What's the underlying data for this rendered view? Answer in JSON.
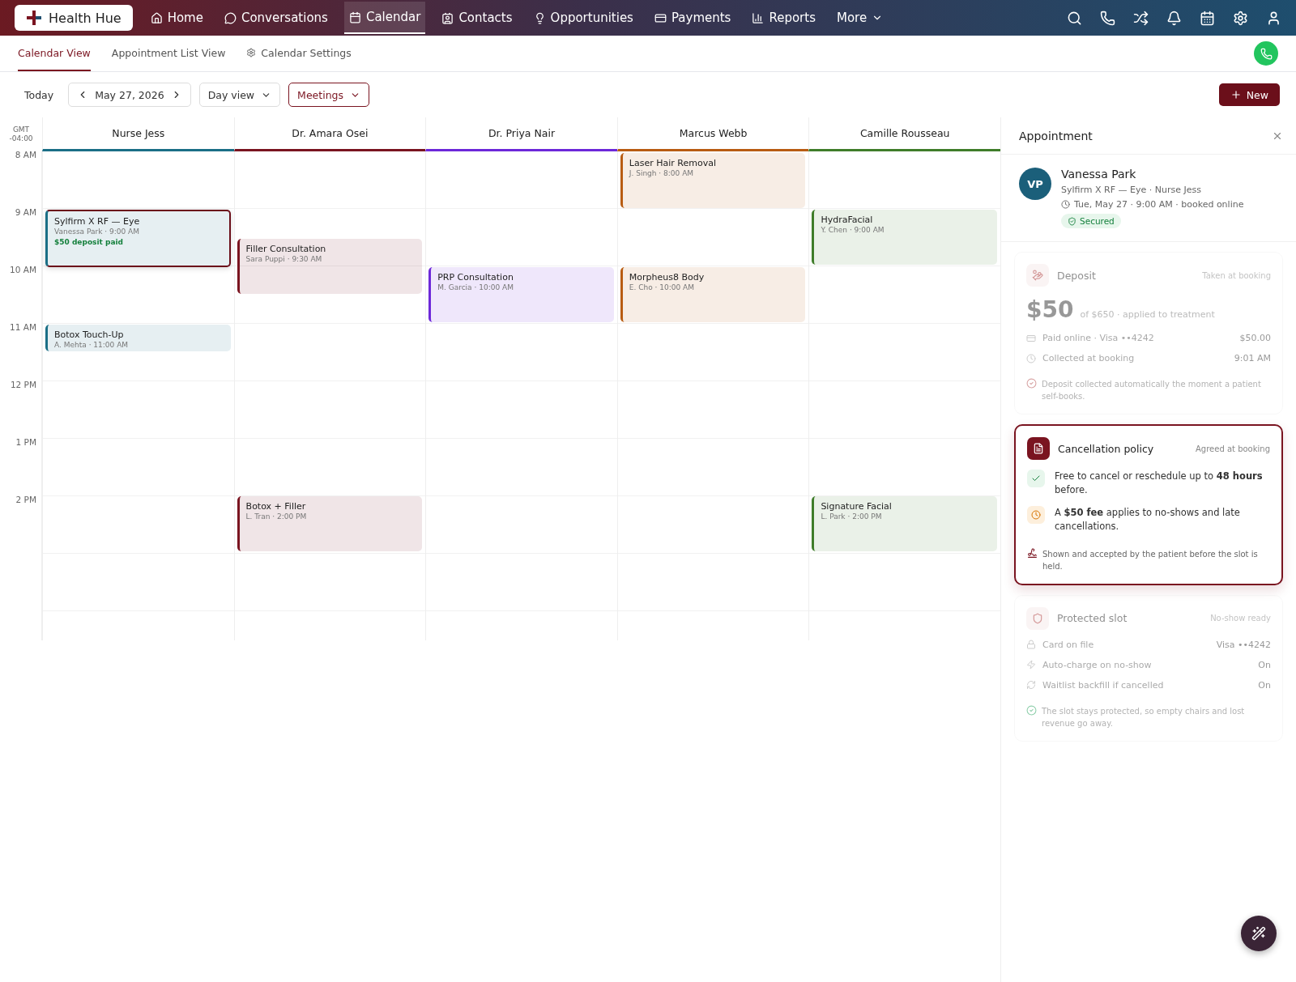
{
  "nav": {
    "brand": "Health Hue",
    "items": [
      {
        "label": "Home",
        "selected": false
      },
      {
        "label": "Conversations",
        "selected": false
      },
      {
        "label": "Calendar",
        "selected": true
      },
      {
        "label": "Contacts",
        "selected": false
      },
      {
        "label": "Opportunities",
        "selected": false
      },
      {
        "label": "Payments",
        "selected": false
      },
      {
        "label": "Reports",
        "selected": false
      },
      {
        "label": "More",
        "selected": false
      }
    ]
  },
  "subtabs": [
    {
      "label": "Calendar View",
      "selected": true
    },
    {
      "label": "Appointment List View",
      "selected": false
    },
    {
      "label": "Calendar Settings",
      "selected": false
    }
  ],
  "toolbar": {
    "today": "Today",
    "date": "May 27, 2026",
    "view": "Day view",
    "filter": "Meetings",
    "new": "New"
  },
  "calendar": {
    "timezone": "GMT -04:00",
    "hours": [
      "8 AM",
      "9 AM",
      "10 AM",
      "11 AM",
      "12 PM",
      "1 PM",
      "2 PM"
    ],
    "columns": [
      {
        "name": "Nurse Jess",
        "color": "#1b6f86",
        "events": [
          {
            "title": "Sylfirm X RF — Eye",
            "detail": "Vanessa Park · 9:00 AM",
            "note": "$50 deposit paid",
            "selected": true
          },
          {
            "title": "Botox Touch-Up",
            "detail": "A. Mehta · 11:00 AM",
            "selected": false
          }
        ]
      },
      {
        "name": "Dr. Amara Osei",
        "color": "#7a1420",
        "events": [
          {
            "title": "Filler Consultation",
            "detail": "Sara Puppi · 9:30 AM",
            "selected": false
          },
          {
            "title": "Botox + Filler",
            "detail": "L. Tran · 2:00 PM",
            "selected": false
          }
        ]
      },
      {
        "name": "Dr. Priya Nair",
        "color": "#6d28d9",
        "events": [
          {
            "title": "PRP Consultation",
            "detail": "M. Garcia · 10:00 AM",
            "selected": false
          }
        ]
      },
      {
        "name": "Marcus Webb",
        "color": "#b85c12",
        "events": [
          {
            "title": "Laser Hair Removal",
            "detail": "J. Singh · 8:00 AM",
            "selected": false
          },
          {
            "title": "Morpheus8 Body",
            "detail": "E. Cho · 10:00 AM",
            "selected": false
          }
        ]
      },
      {
        "name": "Camille Rousseau",
        "color": "#3f7d2a",
        "events": [
          {
            "title": "HydraFacial",
            "detail": "Y. Chen · 9:00 AM",
            "selected": false
          },
          {
            "title": "Signature Facial",
            "detail": "L. Park · 2:00 PM",
            "selected": false
          }
        ]
      }
    ]
  },
  "panel": {
    "title": "Appointment",
    "patient": {
      "initials": "VP",
      "name": "Vanessa Park",
      "service": "Sylfirm X RF — Eye · Nurse Jess",
      "when": "Tue, May 27 · 9:00 AM · booked online",
      "badge": "Secured"
    },
    "cards": [
      {
        "kind": "deposit",
        "highlighted": false,
        "title": "Deposit",
        "note": "Taken at booking",
        "amount": "$50",
        "amount_detail": "of $650 · applied to treatment",
        "rows": [
          {
            "label": "Paid online · Visa ••4242",
            "value": "$50.00"
          },
          {
            "label": "Collected at booking",
            "value": "9:01 AM"
          }
        ],
        "footer": "Deposit collected automatically the moment a patient self-books."
      },
      {
        "kind": "policy",
        "highlighted": true,
        "title": "Cancellation policy",
        "note": "Agreed at booking",
        "items": [
          {
            "kind": "check",
            "text": "Free to cancel or reschedule up to **48 hours** before."
          },
          {
            "kind": "clock",
            "text": "A **$50 fee** applies to no-shows and late cancellations."
          }
        ],
        "footer": "Shown and accepted by the patient before the slot is held."
      },
      {
        "kind": "protected",
        "highlighted": false,
        "title": "Protected slot",
        "note": "No-show ready",
        "rows": [
          {
            "label": "Card on file",
            "value": "Visa ••4242"
          },
          {
            "label": "Auto-charge on no-show",
            "value": "On"
          },
          {
            "label": "Waitlist backfill if cancelled",
            "value": "On"
          }
        ],
        "footer": "The slot stays protected, so empty chairs and lost revenue go away."
      }
    ]
  }
}
